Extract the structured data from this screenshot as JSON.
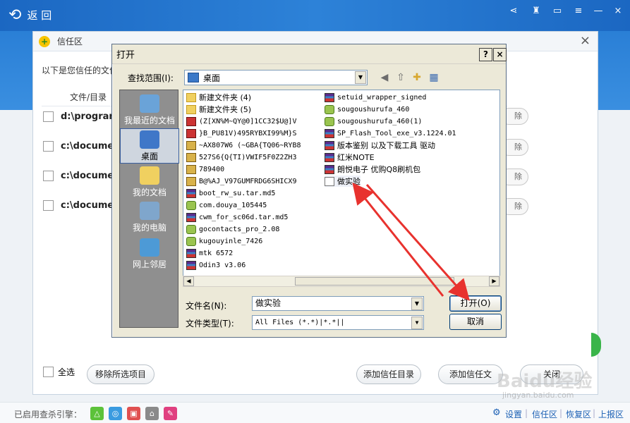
{
  "topbar": {
    "back_label": "返 回",
    "icons": [
      "share-icon",
      "shirt-icon",
      "message-icon",
      "menu-icon",
      "minimize-icon",
      "close-icon"
    ]
  },
  "trust": {
    "title": "信任区",
    "intro": "以下是您信任的文件",
    "col_header": "文件/目录",
    "rows": [
      {
        "path": "d:\\program",
        "btn": "除"
      },
      {
        "path": "c:\\documen",
        "btn": "除"
      },
      {
        "path": "c:\\documen",
        "btn": "除"
      },
      {
        "path": "c:\\documen",
        "btn": "除"
      }
    ],
    "select_all": "全选",
    "remove_selected": "移除所选项目",
    "add_dir": "添加信任目录",
    "add_file": "添加信任文",
    "close_btn": "关闭",
    "close_icon": "×"
  },
  "dialog": {
    "title": "打开",
    "help": "?",
    "close": "×",
    "look_in_label": "查找范围(I):",
    "look_in_value": "桌面",
    "places": [
      {
        "label": "我最近的文档",
        "icon": "recent-documents-icon",
        "color": "#6aa3d8"
      },
      {
        "label": "桌面",
        "icon": "desktop-icon",
        "color": "#3f77c8"
      },
      {
        "label": "我的文档",
        "icon": "my-documents-icon",
        "color": "#f0d060"
      },
      {
        "label": "我的电脑",
        "icon": "my-computer-icon",
        "color": "#7fa6cc"
      },
      {
        "label": "网上邻居",
        "icon": "network-icon",
        "color": "#4d9ad6"
      }
    ],
    "files_col1": [
      {
        "name": "新建文件夹 (4)",
        "type": "folder"
      },
      {
        "name": "新建文件夹 (5)",
        "type": "folder"
      },
      {
        "name": "(Z[XN%M~QY@0]1CC32$U@]V",
        "type": "png"
      },
      {
        "name": "}B_PU81V)495RYBXI99%M}S",
        "type": "png"
      },
      {
        "name": "~AX807W6 (~GBA{TQ06~RYB8",
        "type": "jpg"
      },
      {
        "name": "527S6{Q{TI)VWIF5F0Z2ZH3",
        "type": "jpg"
      },
      {
        "name": "789400",
        "type": "jpg"
      },
      {
        "name": "B@%AJ_V97GUMFRDG6SHICX9",
        "type": "jpg"
      },
      {
        "name": "boot_rw_su.tar.md5",
        "type": "rar"
      },
      {
        "name": "com.douya_105445",
        "type": "apk"
      },
      {
        "name": "cwm_for_sc06d.tar.md5",
        "type": "rar"
      },
      {
        "name": "gocontacts_pro_2.08",
        "type": "apk"
      },
      {
        "name": "kugouyinle_7426",
        "type": "apk"
      },
      {
        "name": "mtk 6572",
        "type": "rar"
      },
      {
        "name": "Odin3 v3.06",
        "type": "rar"
      }
    ],
    "files_col2": [
      {
        "name": "setuid_wrapper_signed",
        "type": "rar"
      },
      {
        "name": "sougoushurufa_460",
        "type": "apk"
      },
      {
        "name": "sougoushurufa_460(1)",
        "type": "apk"
      },
      {
        "name": "SP_Flash_Tool_exe_v3.1224.01",
        "type": "rar"
      },
      {
        "name": "版本鉴别 以及下载工具 驱动",
        "type": "rar"
      },
      {
        "name": "红米NOTE",
        "type": "rar"
      },
      {
        "name": "朗悦电子 优购Q8刷机包",
        "type": "rar"
      },
      {
        "name": "做实验",
        "type": "txt"
      }
    ],
    "filename_label": "文件名(N):",
    "filename_value": "做实验",
    "filetype_label": "文件类型(T):",
    "filetype_value": "All Files (*.*)|*.*||",
    "open_btn": "打开(O)",
    "cancel_btn": "取消"
  },
  "status": {
    "engine_label": "已启用查杀引擎：",
    "engines": [
      {
        "icon": "engine-1-icon",
        "color": "#5cc23a"
      },
      {
        "icon": "engine-2-icon",
        "color": "#3a9be0"
      },
      {
        "icon": "engine-3-icon",
        "color": "#e05050"
      },
      {
        "icon": "engine-4-icon",
        "color": "#8a8a8a"
      },
      {
        "icon": "engine-5-icon",
        "color": "#e04080"
      }
    ],
    "settings": "设置",
    "trust_zone": "信任区",
    "restore": "恢复区",
    "report": "上报区"
  },
  "watermark": {
    "brand": "Baidu经验",
    "url": "jingyan.baidu.com"
  }
}
